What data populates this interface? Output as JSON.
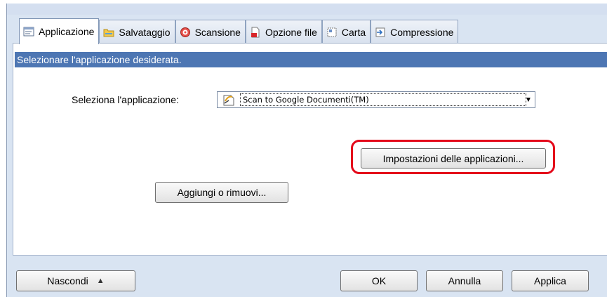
{
  "tabs": [
    {
      "label": "Applicazione",
      "icon": "application-icon",
      "active": true
    },
    {
      "label": "Salvataggio",
      "icon": "folder-icon",
      "active": false
    },
    {
      "label": "Scansione",
      "icon": "scan-icon",
      "active": false
    },
    {
      "label": "Opzione file",
      "icon": "file-option-icon",
      "active": false
    },
    {
      "label": "Carta",
      "icon": "paper-icon",
      "active": false
    },
    {
      "label": "Compressione",
      "icon": "compression-icon",
      "active": false
    }
  ],
  "panel": {
    "banner": "Selezionare l'applicazione desiderata.",
    "select_label": "Seleziona l'applicazione:",
    "select_value": "Scan to Google Documenti(TM)",
    "app_settings_button": "Impostazioni delle applicazioni...",
    "add_remove_button": "Aggiungi o rimuovi..."
  },
  "footer": {
    "hide_button": "Nascondi",
    "ok_button": "OK",
    "cancel_button": "Annulla",
    "apply_button": "Applica"
  },
  "colors": {
    "banner": "#4d76b3",
    "window_bg": "#d9e4f2",
    "highlight": "#e4081a"
  }
}
